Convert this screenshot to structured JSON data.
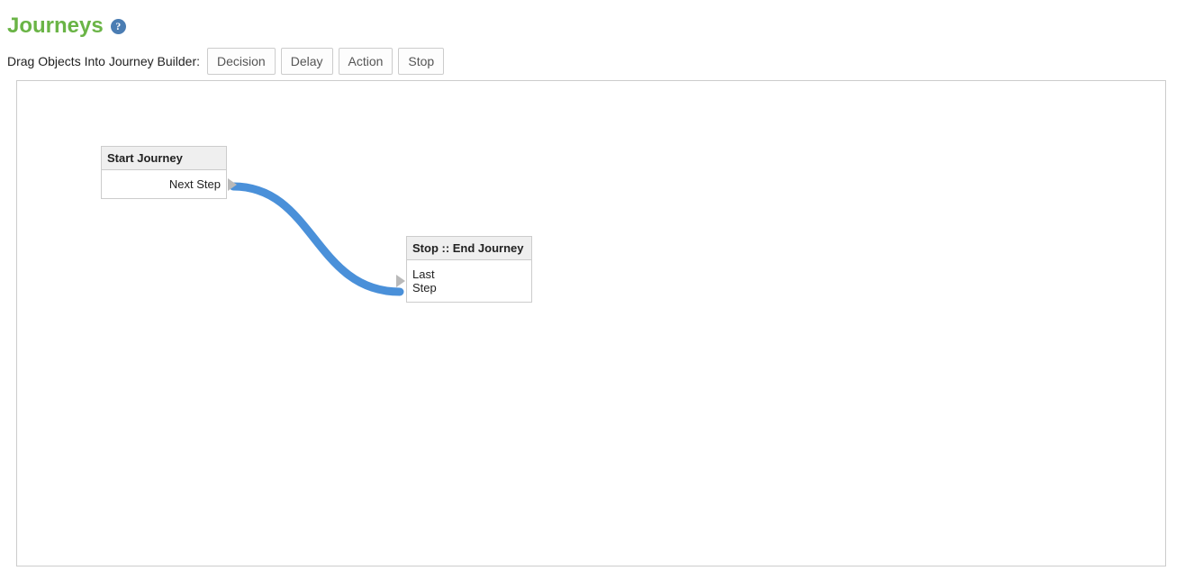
{
  "page": {
    "title": "Journeys"
  },
  "toolbar": {
    "label": "Drag Objects Into Journey Builder:",
    "buttons": {
      "decision": "Decision",
      "delay": "Delay",
      "action": "Action",
      "stop": "Stop"
    }
  },
  "nodes": {
    "start": {
      "title": "Start Journey",
      "body": "Next Step"
    },
    "stop": {
      "title": "Stop :: End Journey",
      "body": "Last Step"
    }
  }
}
